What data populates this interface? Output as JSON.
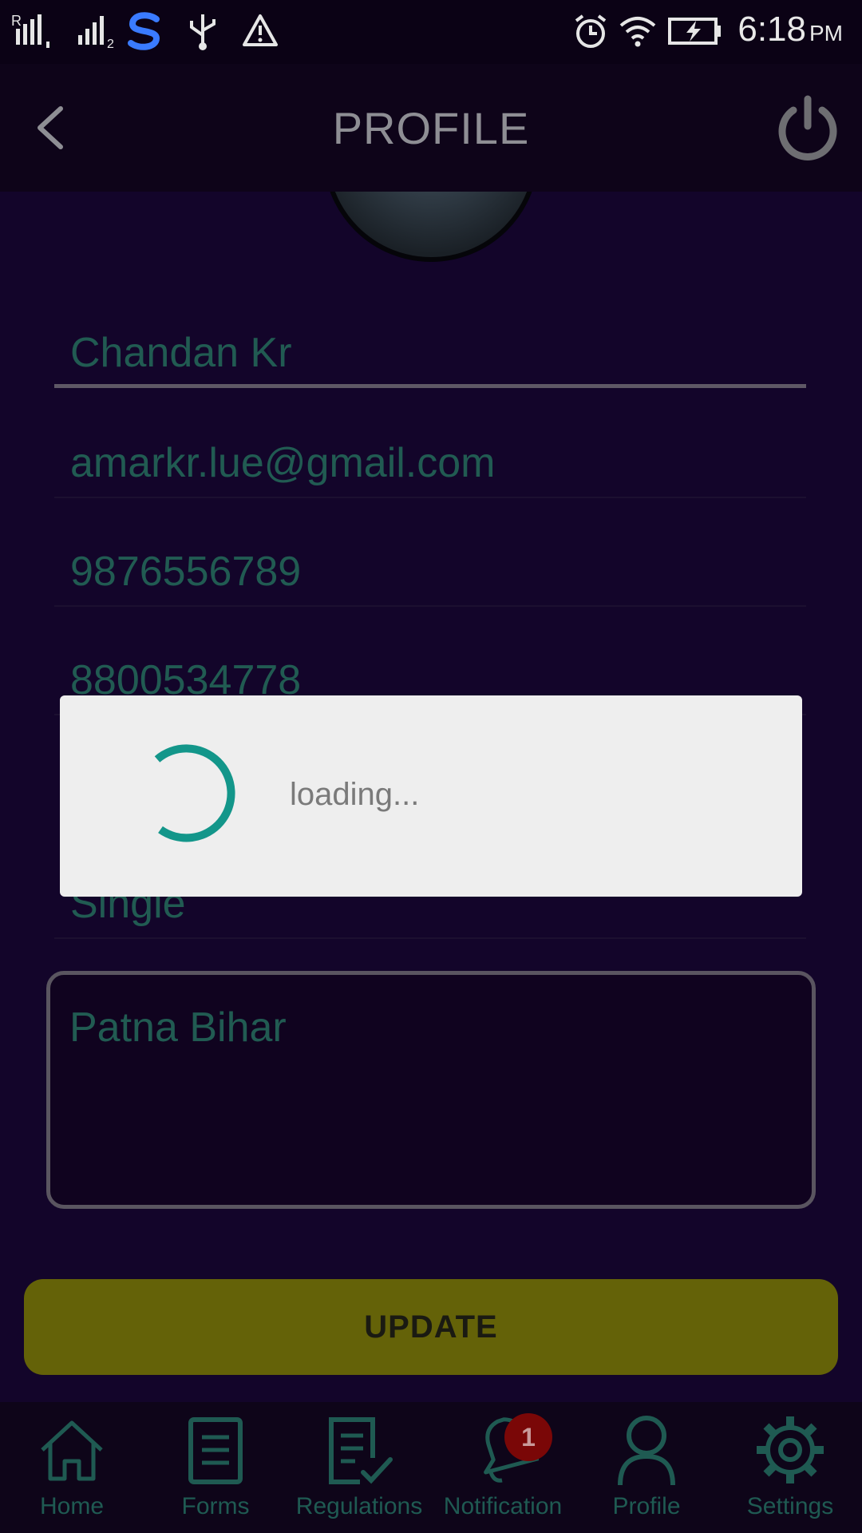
{
  "status_bar": {
    "time": "6:18",
    "ampm": "PM",
    "signal1_label": "R",
    "signal2_sub": "2",
    "icons": [
      "signal-icon",
      "signal-2-icon",
      "s-app-icon",
      "usb-icon",
      "warning-icon",
      "alarm-icon",
      "wifi-icon",
      "battery-charging-icon"
    ]
  },
  "toolbar": {
    "title": "PROFILE",
    "back_icon": "chevron-left-icon",
    "power_icon": "power-icon"
  },
  "form": {
    "name": "Chandan Kr",
    "email": "amarkr.lue@gmail.com",
    "phone": "9876556789",
    "alt_phone": "8800534778",
    "marital_status": "Single",
    "address": "Patna Bihar",
    "update_label": "UPDATE"
  },
  "dialog": {
    "message": "loading...",
    "spinner_color": "#13968a"
  },
  "bottom_nav": {
    "items": [
      {
        "label": "Home",
        "icon": "home-icon"
      },
      {
        "label": "Forms",
        "icon": "document-icon"
      },
      {
        "label": "Regulations",
        "icon": "checklist-icon"
      },
      {
        "label": "Notification",
        "icon": "bell-icon",
        "badge": "1"
      },
      {
        "label": "Profile",
        "icon": "person-icon"
      },
      {
        "label": "Settings",
        "icon": "gear-icon"
      }
    ]
  },
  "colors": {
    "accent_teal": "#1f5a52",
    "update_button": "#646208",
    "badge": "#7a0707"
  }
}
